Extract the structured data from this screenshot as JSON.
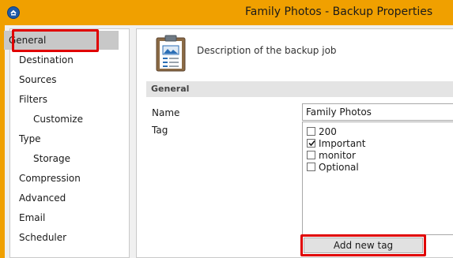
{
  "window": {
    "title": "Family Photos - Backup Properties"
  },
  "sidebar": {
    "items": [
      {
        "label": "General",
        "selected": true
      },
      {
        "label": "Destination"
      },
      {
        "label": "Sources"
      },
      {
        "label": "Filters"
      },
      {
        "label": "Customize",
        "sub": true
      },
      {
        "label": "Type"
      },
      {
        "label": "Storage",
        "sub": true
      },
      {
        "label": "Compression"
      },
      {
        "label": "Advanced"
      },
      {
        "label": "Email"
      },
      {
        "label": "Scheduler"
      }
    ]
  },
  "main": {
    "description": "Description of the backup job",
    "section_title": "General",
    "name_label": "Name",
    "name_value": "Family Photos",
    "tag_label": "Tag",
    "tags": [
      {
        "label": "200",
        "checked": false
      },
      {
        "label": "Important",
        "checked": true
      },
      {
        "label": "monitor",
        "checked": false
      },
      {
        "label": "Optional",
        "checked": false
      }
    ],
    "add_tag_label": "Add new tag"
  },
  "colors": {
    "title_bar": "#f0a000",
    "highlight": "#e00000",
    "selected_item": "#c8c8c8"
  },
  "icons": [
    "app-icon",
    "clipboard-icon",
    "checkmark-icon"
  ]
}
